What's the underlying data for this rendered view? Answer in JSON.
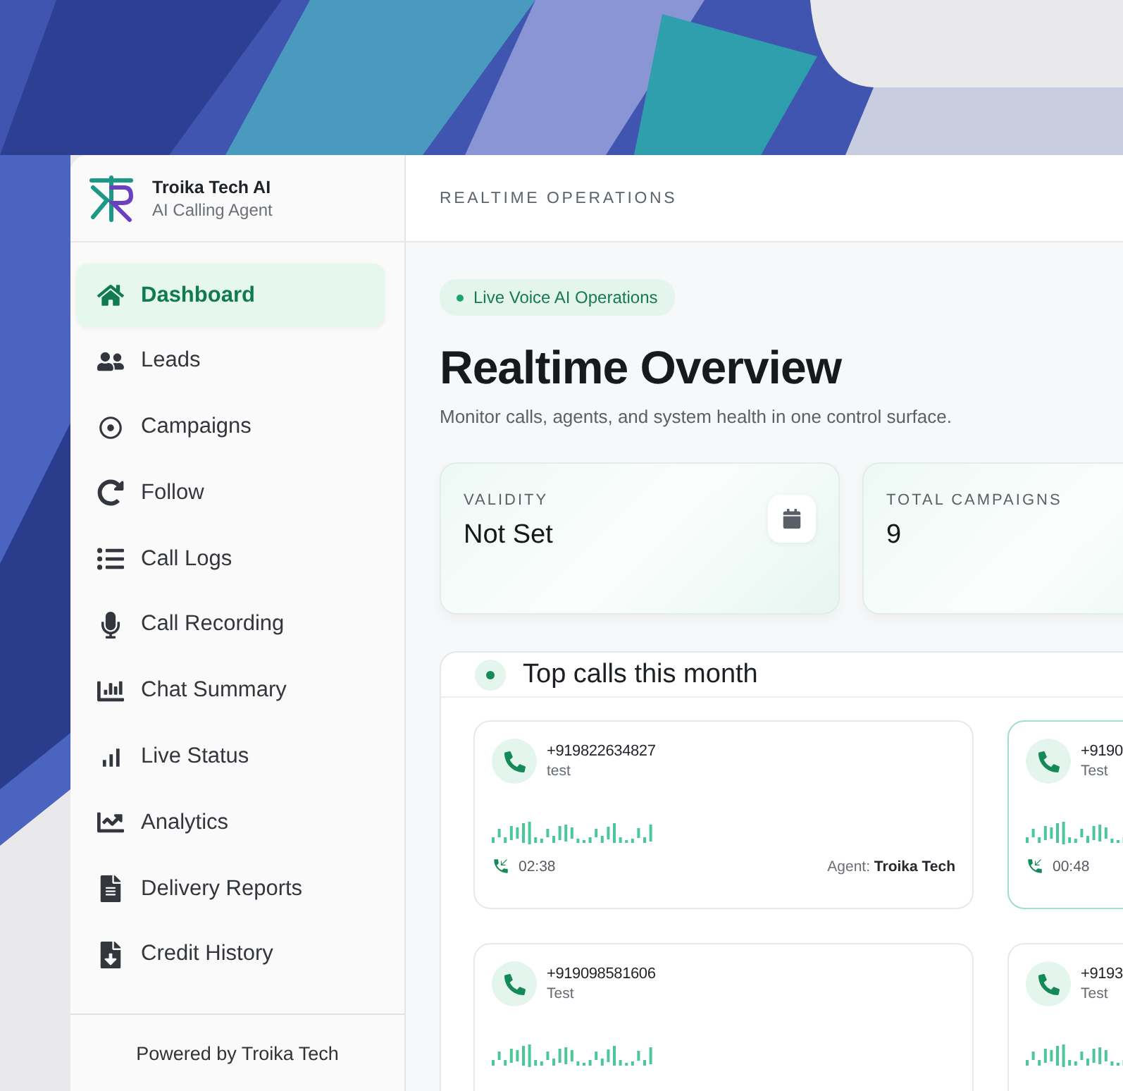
{
  "brand": {
    "name": "Troika Tech AI",
    "tagline": "AI Calling Agent"
  },
  "sidebar": {
    "items": [
      {
        "label": "Dashboard",
        "selected": true
      },
      {
        "label": "Leads",
        "selected": false
      },
      {
        "label": "Campaigns",
        "selected": false
      },
      {
        "label": "Follow",
        "selected": false
      },
      {
        "label": "Call Logs",
        "selected": false
      },
      {
        "label": "Call Recording",
        "selected": false
      },
      {
        "label": "Chat Summary",
        "selected": false
      },
      {
        "label": "Live Status",
        "selected": false
      },
      {
        "label": "Analytics",
        "selected": false
      },
      {
        "label": "Delivery Reports",
        "selected": false
      },
      {
        "label": "Credit History",
        "selected": false
      }
    ],
    "footer": "Powered by Troika Tech"
  },
  "header": {
    "title": "REALTIME OPERATIONS"
  },
  "hero": {
    "badge": "Live Voice AI Operations",
    "title": "Realtime Overview",
    "subtitle": "Monitor calls, agents, and system health in one control surface."
  },
  "stats": [
    {
      "label": "VALIDITY",
      "value": "Not Set",
      "kind": "calendar"
    },
    {
      "label": "TOTAL CAMPAIGNS",
      "value": "9",
      "kind": "plain"
    }
  ],
  "top_calls": {
    "title": "Top calls this month",
    "calls": [
      {
        "phone": "+919822634827",
        "name": "test",
        "duration": "02:38",
        "agent_label": "Agent:",
        "agent": "Troika Tech",
        "selected": false
      },
      {
        "phone": "+9190",
        "name": "Test",
        "duration": "00:48",
        "selected": true
      },
      {
        "phone": "+919098581606",
        "name": "Test",
        "selected": false
      },
      {
        "phone": "+9193",
        "name": "Test",
        "selected": false
      }
    ]
  }
}
